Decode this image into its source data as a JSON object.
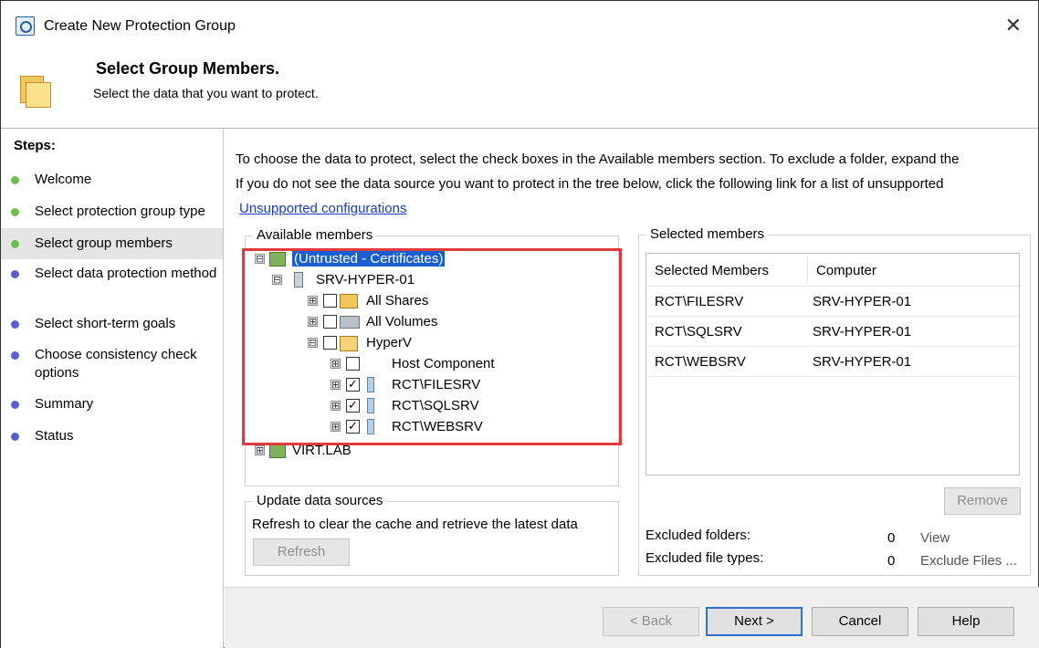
{
  "window": {
    "title": "Create New Protection Group",
    "close_symbol": "✕"
  },
  "header": {
    "title": "Select Group Members.",
    "subtitle": "Select the data that you want to protect."
  },
  "steps": {
    "heading": "Steps:",
    "items": [
      {
        "label": "Welcome",
        "color": "#6cbf4a"
      },
      {
        "label": "Select protection group type",
        "color": "#6cbf4a"
      },
      {
        "label": "Select group members",
        "color": "#6cbf4a"
      },
      {
        "label": "Select data protection method",
        "color": "#5a5fcf"
      },
      {
        "label": "Select short-term goals",
        "color": "#5a5fcf"
      },
      {
        "label": "Choose consistency check options",
        "color": "#5a5fcf"
      },
      {
        "label": "Summary",
        "color": "#5a5fcf"
      },
      {
        "label": "Status",
        "color": "#5a5fcf"
      }
    ]
  },
  "content": {
    "intro_line1": "To choose the data to protect, select the check boxes in the Available members section. To exclude a folder, expand the",
    "intro_line2": "If you do not see the data source you want to protect in the tree below, click the following link for a list of unsupported",
    "link": "Unsupported configurations"
  },
  "available": {
    "title": "Available members",
    "tree": [
      {
        "label": "(Untrusted - Certificates)",
        "expander": "⊟"
      },
      {
        "label": "SRV-HYPER-01",
        "expander": "⊟"
      },
      {
        "label": "All Shares",
        "expander": "⊞",
        "check": ""
      },
      {
        "label": "All Volumes",
        "expander": "⊞",
        "check": ""
      },
      {
        "label": "HyperV",
        "expander": "⊟",
        "check": ""
      },
      {
        "label": "Host Component",
        "expander": "⊞",
        "check": ""
      },
      {
        "label": "RCT\\FILESRV",
        "expander": "⊞",
        "check": "✓"
      },
      {
        "label": "RCT\\SQLSRV",
        "expander": "⊞",
        "check": "✓"
      },
      {
        "label": "RCT\\WEBSRV",
        "expander": "⊞",
        "check": "✓"
      },
      {
        "label": "VIRT.LAB",
        "expander": "⊞"
      }
    ]
  },
  "update": {
    "title": "Update data sources",
    "text": "Refresh to clear the cache and retrieve the latest data",
    "refresh_label": "Refresh"
  },
  "selected": {
    "title": "Selected members",
    "columns": [
      "Selected Members",
      "Computer"
    ],
    "rows": [
      {
        "member": "RCT\\FILESRV",
        "computer": "SRV-HYPER-01"
      },
      {
        "member": "RCT\\SQLSRV",
        "computer": "SRV-HYPER-01"
      },
      {
        "member": "RCT\\WEBSRV",
        "computer": "SRV-HYPER-01"
      }
    ],
    "remove_label": "Remove",
    "excluded_folders_label": "Excluded folders:",
    "excluded_folders_count": "0",
    "excluded_folders_link": "View",
    "excluded_types_label": "Excluded file types:",
    "excluded_types_count": "0",
    "excluded_types_link": "Exclude Files ..."
  },
  "footer": {
    "back": "< Back",
    "next": "Next >",
    "cancel": "Cancel",
    "help": "Help"
  }
}
